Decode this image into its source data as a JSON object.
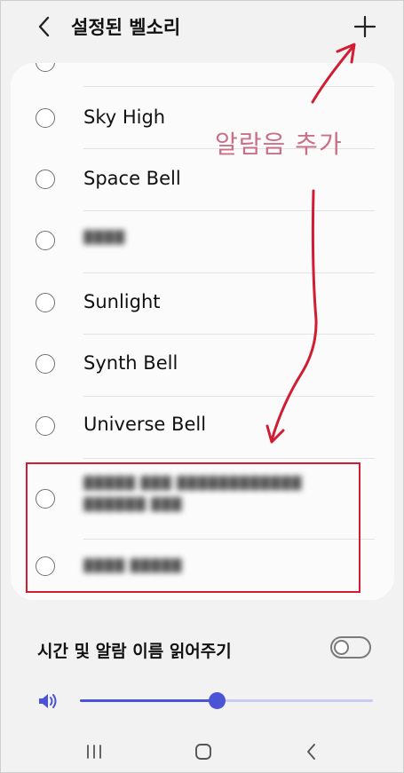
{
  "header": {
    "title": "설정된 벨소리",
    "back_icon": "chevron-left-icon",
    "add_icon": "plus-icon"
  },
  "ringtones": [
    {
      "label": "Sky High",
      "blurred": false,
      "selected": false
    },
    {
      "label": "Space Bell",
      "blurred": false,
      "selected": false
    },
    {
      "label": "▓▓▓▓",
      "blurred": true,
      "selected": false
    },
    {
      "label": "Sunlight",
      "blurred": false,
      "selected": false
    },
    {
      "label": "Synth Bell",
      "blurred": false,
      "selected": false
    },
    {
      "label": "Universe Bell",
      "blurred": false,
      "selected": false
    },
    {
      "label": "▓▓▓▓▓ ▓▓▓ ▓▓▓▓▓▓▓▓▓▓▓▓",
      "label2": "▓▓▓▓▓▓ ▓▓▓",
      "blurred": true,
      "selected": false
    },
    {
      "label": "▓▓▓▓ ▓▓▓▓▓",
      "blurred": true,
      "selected": false
    }
  ],
  "annotation": {
    "text": "알람음 추가",
    "arrow_color": "#d11d34",
    "text_color": "#c97088"
  },
  "read_aloud": {
    "label": "시간 및 알람 이름 읽어주기",
    "enabled": false
  },
  "volume": {
    "icon": "speaker-icon",
    "level": 0.47,
    "color": "#4c54d6"
  },
  "navbar": {
    "recents_icon": "recents-icon",
    "home_icon": "home-icon",
    "back_icon": "nav-back-icon"
  }
}
